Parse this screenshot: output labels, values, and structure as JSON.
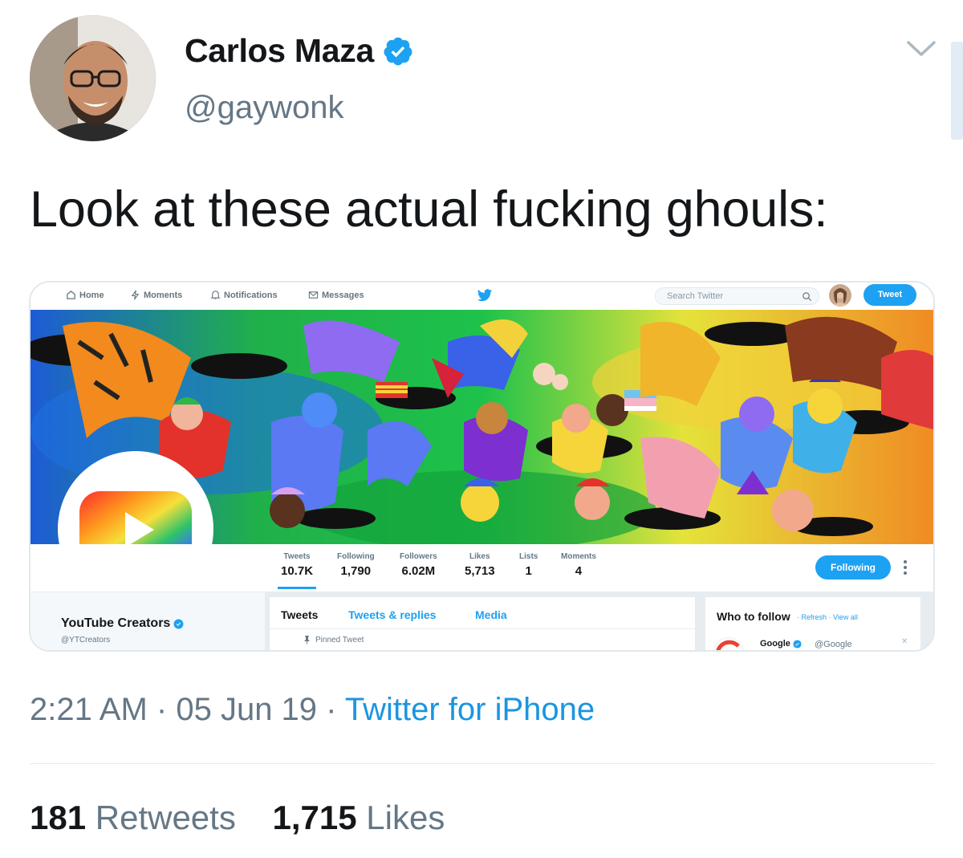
{
  "tweet": {
    "author": {
      "display_name": "Carlos Maza",
      "handle": "@gaywonk",
      "verified": true
    },
    "text": "Look at these actual fucking ghouls:",
    "meta": {
      "time": "2:21 AM",
      "separator": "·",
      "date": "05 Jun 19",
      "source": "Twitter for iPhone"
    },
    "stats": {
      "retweets_count": "181",
      "retweets_label": "Retweets",
      "likes_count": "1,715",
      "likes_label": "Likes"
    },
    "icons": {
      "menu": "chevron-down-icon",
      "verified": "verified-badge-icon"
    },
    "colors": {
      "accent": "#1da1f2",
      "link": "#1b95e0",
      "secondary_text": "#657786"
    }
  },
  "embedded_screenshot": {
    "nav": {
      "home": "Home",
      "moments": "Moments",
      "notifications": "Notifications",
      "messages": "Messages",
      "search_placeholder": "Search Twitter",
      "tweet_button": "Tweet"
    },
    "profile_stats": [
      {
        "label": "Tweets",
        "value": "10.7K"
      },
      {
        "label": "Following",
        "value": "1,790"
      },
      {
        "label": "Followers",
        "value": "6.02M"
      },
      {
        "label": "Likes",
        "value": "5,713"
      },
      {
        "label": "Lists",
        "value": "1"
      },
      {
        "label": "Moments",
        "value": "4"
      }
    ],
    "following_button": "Following",
    "profile": {
      "name": "YouTube Creators",
      "handle": "@YTCreators"
    },
    "tabs": [
      "Tweets",
      "Tweets & replies",
      "Media"
    ],
    "pinned_label": "Pinned Tweet",
    "who_to_follow": {
      "title": "Who to follow",
      "links": "· Refresh · View all",
      "suggestion_name": "Google",
      "suggestion_handle": "@Google"
    }
  }
}
